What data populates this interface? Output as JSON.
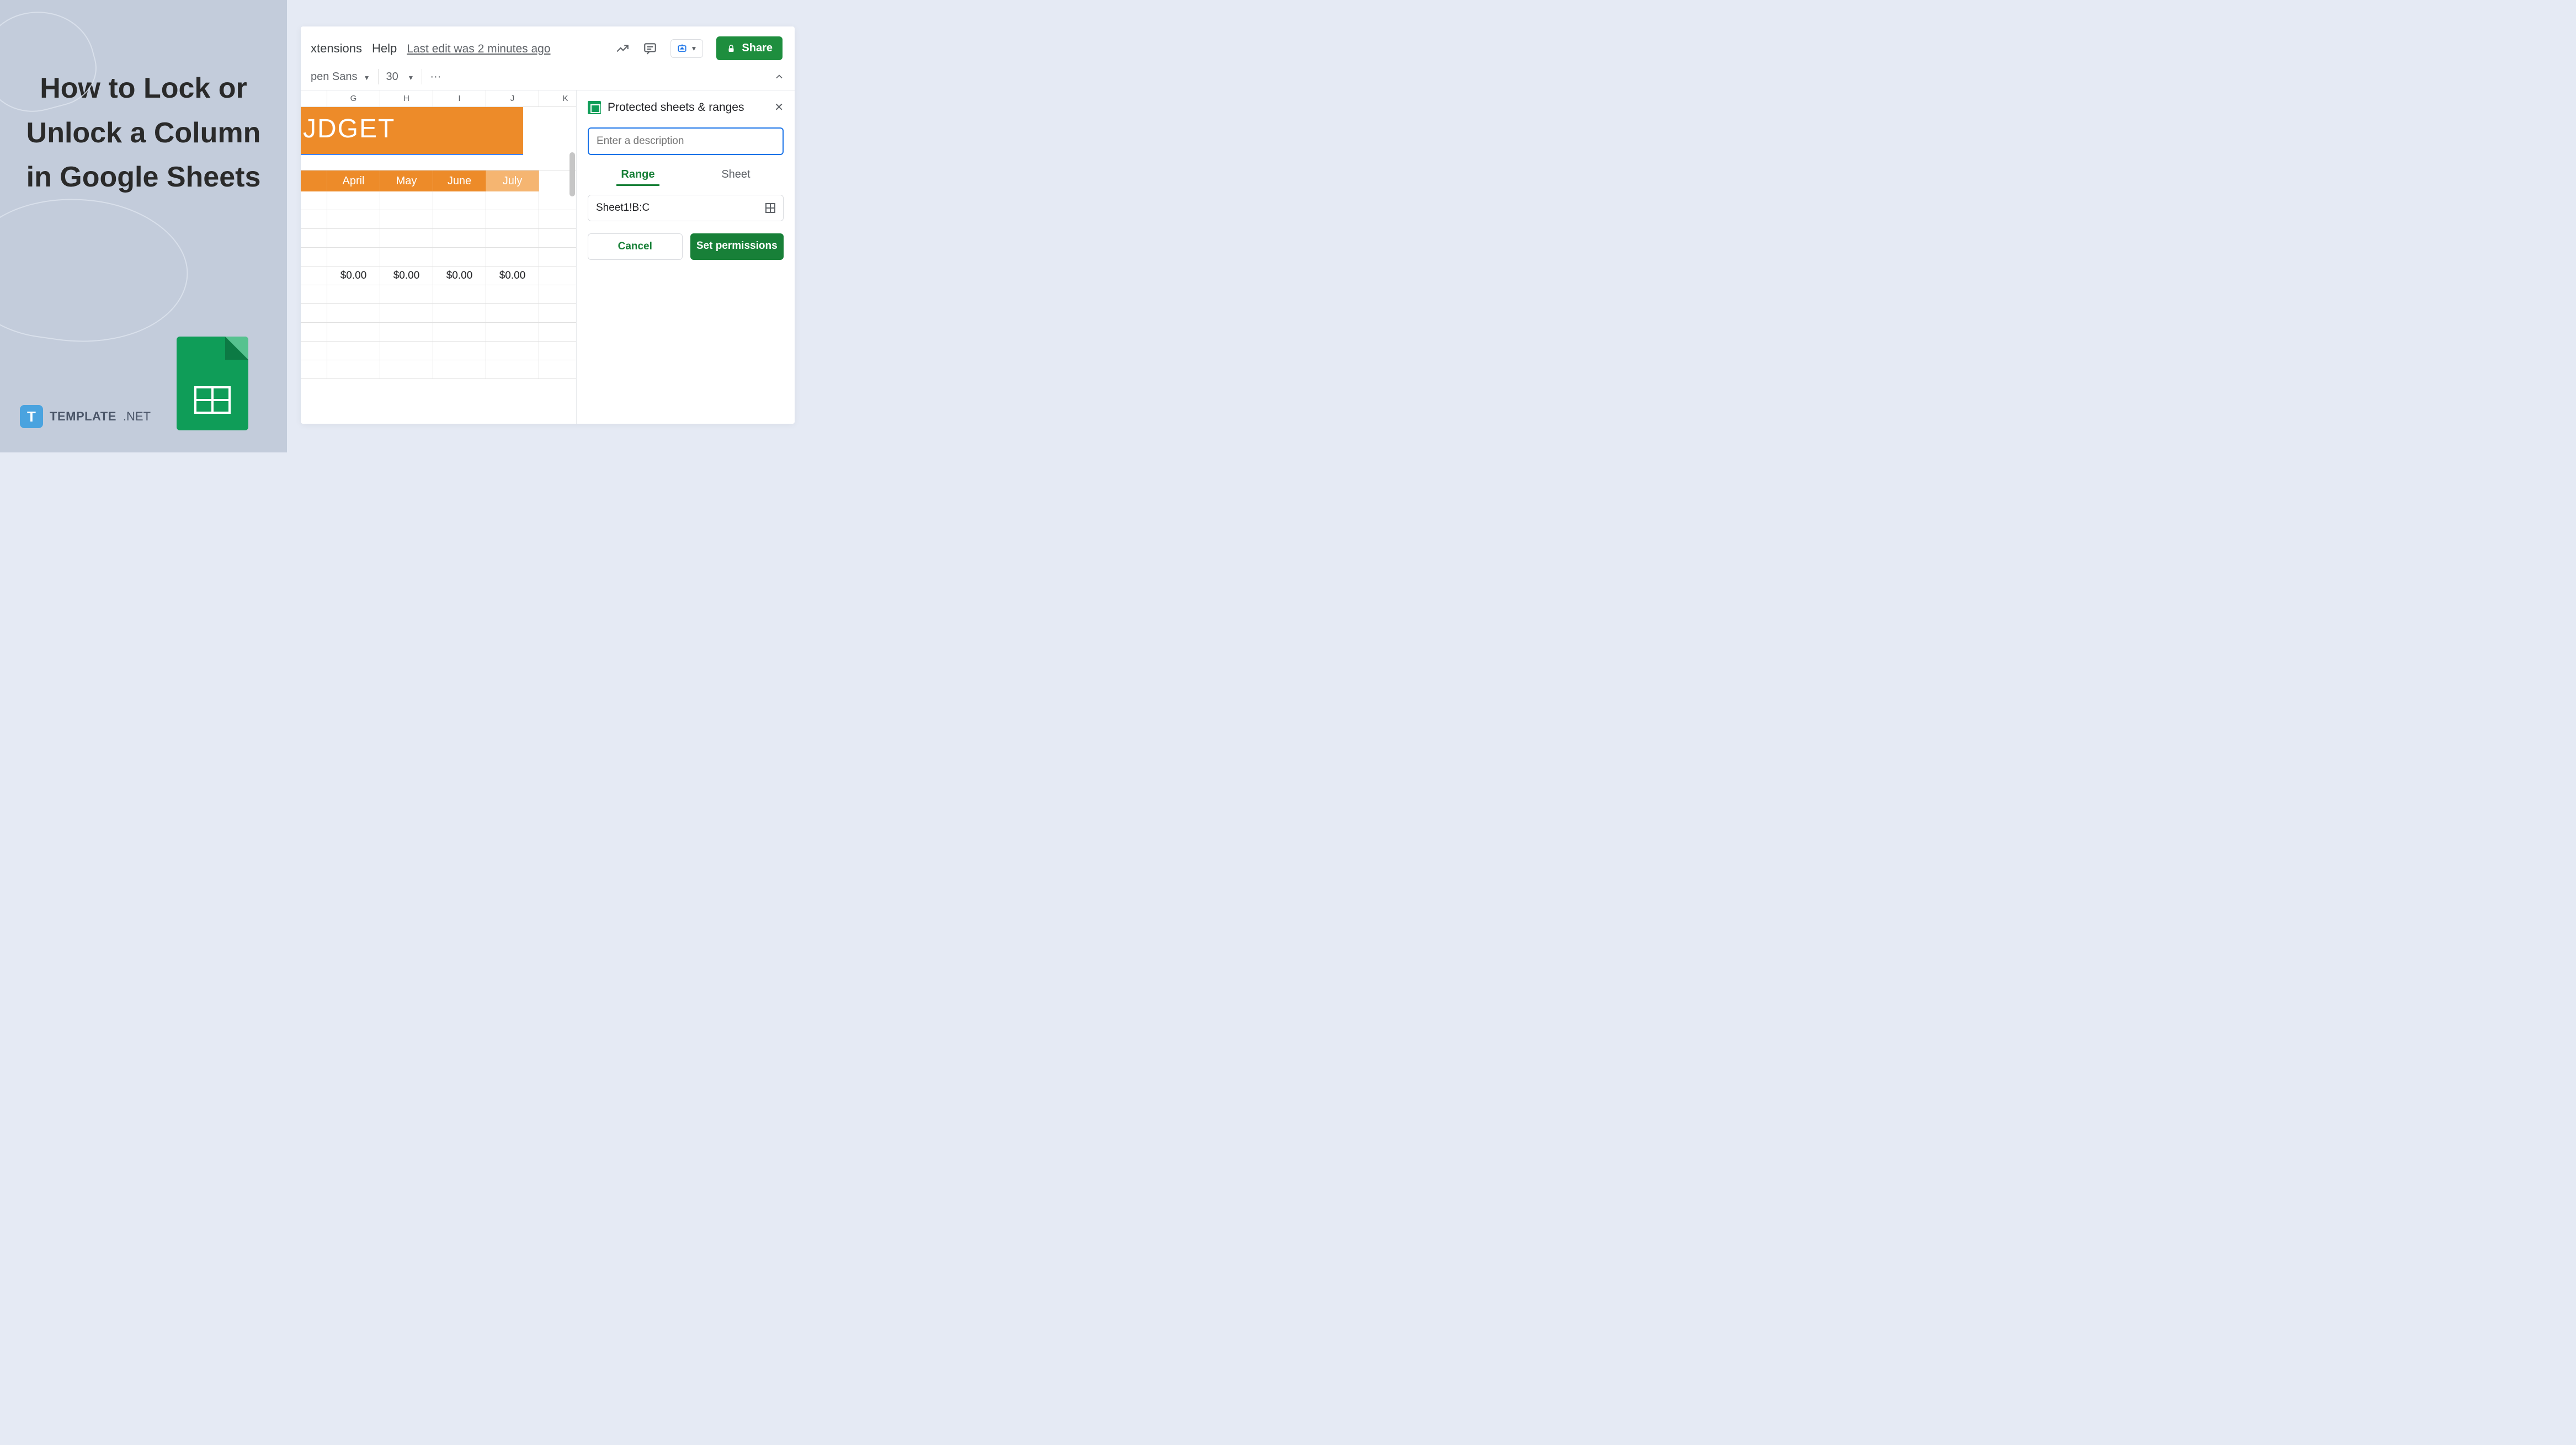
{
  "left": {
    "title": "How to Lock or Unlock a Column in Google Sheets",
    "brand_main": "TEMPLATE",
    "brand_suffix": ".NET",
    "brand_icon_letter": "T"
  },
  "menu": {
    "extensions": "xtensions",
    "help": "Help",
    "last_edit": "Last edit was 2 minutes ago"
  },
  "toolbar": {
    "font": "pen Sans",
    "size": "30",
    "more": "···"
  },
  "share": {
    "label": "Share"
  },
  "columns": [
    "G",
    "H",
    "I",
    "J",
    "K"
  ],
  "banner_text": "JDGET",
  "months": [
    "April",
    "May",
    "June",
    "July"
  ],
  "values_row": [
    "$0.00",
    "$0.00",
    "$0.00",
    "$0.00"
  ],
  "panel": {
    "title": "Protected sheets & ranges",
    "desc_placeholder": "Enter a description",
    "tab_range": "Range",
    "tab_sheet": "Sheet",
    "range_value": "Sheet1!B:C",
    "cancel": "Cancel",
    "set_permissions": "Set permissions"
  }
}
